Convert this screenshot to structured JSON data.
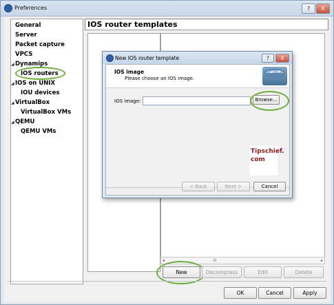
{
  "window": {
    "title": "Preferences",
    "help_glyph": "?",
    "close_glyph": "X"
  },
  "sidebar": {
    "items": [
      {
        "label": "General"
      },
      {
        "label": "Server"
      },
      {
        "label": "Packet capture"
      },
      {
        "label": "VPCS"
      },
      {
        "label": "Dynamips",
        "expanded": true
      },
      {
        "label": "IOS routers",
        "selected": true
      },
      {
        "label": "IOS on UNIX",
        "expanded": true
      },
      {
        "label": "IOU devices"
      },
      {
        "label": "VirtualBox",
        "expanded": true
      },
      {
        "label": "VirtualBox VMs"
      },
      {
        "label": "QEMU",
        "expanded": true
      },
      {
        "label": "QEMU VMs"
      }
    ],
    "expand_glyph": "◢"
  },
  "main": {
    "header": "IOS router templates",
    "scroll_grip": "III",
    "scroll_left": "◂",
    "scroll_right": "▸",
    "buttons": {
      "new": "New",
      "decompress": "Decompress",
      "edit": "Edit",
      "delete": "Delete"
    }
  },
  "footer": {
    "ok": "OK",
    "cancel": "Cancel",
    "apply": "Apply"
  },
  "dialog": {
    "title": "New IOS router template",
    "help_glyph": "?",
    "close_glyph": "X",
    "heading": "IOS image",
    "subtitle": "Please choose an IOS image.",
    "field_label": "IOS image:",
    "field_value": "",
    "browse": "Browse...",
    "back": "< Back",
    "next": "Next >",
    "cancel": "Cancel"
  },
  "watermark": {
    "line1": "Tipschief.",
    "line2": "com"
  },
  "colors": {
    "highlight_ring": "#6cad3a",
    "titlebar": "#c7d6e8"
  }
}
